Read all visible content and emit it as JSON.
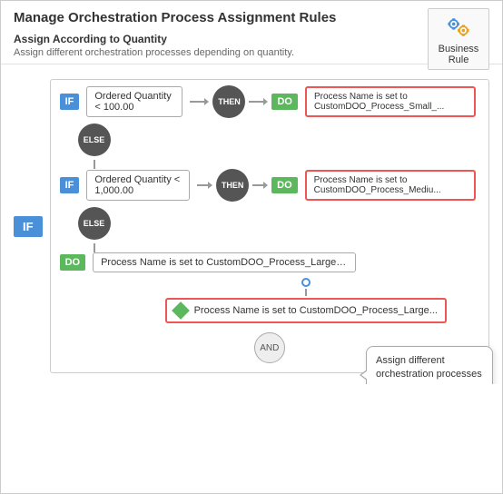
{
  "page": {
    "title": "Manage Orchestration Process Assignment Rules",
    "subheader_title": "Assign According to Quantity",
    "subheader_desc": "Assign different orchestration processes depending on quantity."
  },
  "business_rule": {
    "label": "Business Rule"
  },
  "outer_if": {
    "label": "IF"
  },
  "rule1": {
    "if_label": "IF",
    "condition": "Ordered Quantity < 100.00",
    "then_label": "THEN",
    "do_label": "DO",
    "action": "Process Name is set to CustomDOO_Process_Small_..."
  },
  "else1": {
    "label": "ELSE"
  },
  "rule2": {
    "if_label": "IF",
    "condition": "Ordered Quantity < 1,000.00",
    "then_label": "THEN",
    "do_label": "DO",
    "action": "Process Name is set to CustomDOO_Process_Mediu..."
  },
  "else2": {
    "label": "ELSE"
  },
  "rule3": {
    "do_label": "DO",
    "action": "Process Name is set to CustomDOO_Process_Large_O..."
  },
  "sub_action": {
    "text": "Process Name is set to CustomDOO_Process_Large..."
  },
  "and_badge": {
    "label": "AND"
  },
  "tooltip": {
    "text": "Assign different orchestration processes depending on quantity."
  }
}
